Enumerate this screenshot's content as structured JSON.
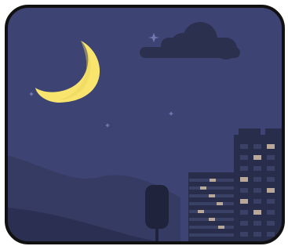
{
  "scene": {
    "subject": "night-city-with-crescent-moon",
    "colors": {
      "frame": "#111111",
      "sky": "#3d4473",
      "moon": "#f9e56d",
      "moon_shadow": "#e6d35a",
      "cloud": "#2c304f",
      "stars": "#6f78b2",
      "hills_far": "#353b62",
      "hills_near": "#2b3052",
      "tower": "#282d4b",
      "window_dark": "#3a4166",
      "window_lit": "#b9a89a",
      "lamp": "#1f233b"
    }
  }
}
